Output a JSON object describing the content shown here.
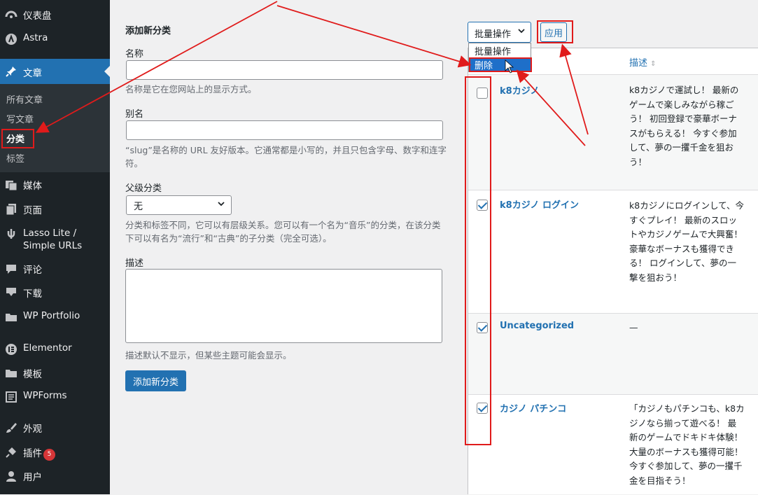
{
  "sidebar": {
    "items": [
      {
        "label": "仪表盘",
        "icon": "dashboard-icon"
      },
      {
        "label": "Astra",
        "icon": "astra-icon"
      },
      {
        "label": "文章",
        "icon": "pin-icon"
      },
      {
        "label": "媒体",
        "icon": "media-icon"
      },
      {
        "label": "页面",
        "icon": "pages-icon"
      },
      {
        "label": "Lasso Lite / Simple URLs",
        "icon": "link-icon"
      },
      {
        "label": "评论",
        "icon": "comment-icon"
      },
      {
        "label": "下载",
        "icon": "download-icon"
      },
      {
        "label": "WP Portfolio",
        "icon": "folder-icon"
      },
      {
        "label": "Elementor",
        "icon": "elementor-icon"
      },
      {
        "label": "模板",
        "icon": "folder-icon"
      },
      {
        "label": "WPForms",
        "icon": "forms-icon"
      },
      {
        "label": "外观",
        "icon": "brush-icon"
      },
      {
        "label": "插件",
        "icon": "plugin-icon",
        "badge": "5"
      },
      {
        "label": "用户",
        "icon": "user-icon"
      }
    ],
    "submenu": [
      "所有文章",
      "写文章",
      "分类",
      "标签"
    ]
  },
  "form": {
    "heading": "添加新分类",
    "name_label": "名称",
    "name_help": "名称是它在您网站上的显示方式。",
    "slug_label": "别名",
    "slug_help": "“slug”是名称的 URL 友好版本。它通常都是小写的，并且只包含字母、数字和连字符。",
    "parent_label": "父级分类",
    "parent_value": "无",
    "parent_help": "分类和标签不同，它可以有层级关系。您可以有一个名为“音乐”的分类，在该分类下可以有名为“流行”和“古典”的子分类（完全可选）。",
    "desc_label": "描述",
    "desc_help": "描述默认不显示，但某些主题可能会显示。",
    "submit": "添加新分类"
  },
  "bulk": {
    "select_value": "批量操作",
    "options": [
      "批量操作",
      "删除"
    ],
    "apply": "应用"
  },
  "table": {
    "desc_header": "描述",
    "rows": [
      {
        "name": "k8カジノ",
        "checked": false,
        "desc": "k8カジノで運試し！ 最新のゲームで楽しみながら稼ごう！ 初回登録で豪華ボーナスがもらえる！ 今すぐ参加して、夢の一攫千金を狙おう！"
      },
      {
        "name": "k8カジノ ログイン",
        "checked": true,
        "desc": "k8カジノにログインして、今すぐプレイ！ 最新のスロットやカジノゲームで大興奮！ 豪華なボーナスも獲得できる！ ログインして、夢の一撃を狙おう！"
      },
      {
        "name": "Uncategorized",
        "checked": true,
        "desc": "—"
      },
      {
        "name": "カジノ パチンコ",
        "checked": true,
        "desc": "「カジノもパチンコも、k8カジノなら揃って遊べる！ 最新のゲームでドキドキ体験！ 大量のボーナスも獲得可能！ 今すぐ参加して、夢の一攫千金を目指そう！"
      }
    ]
  },
  "colors": {
    "accent": "#2271b1",
    "sidebar": "#1d2327",
    "annotation": "#e01b1b"
  }
}
